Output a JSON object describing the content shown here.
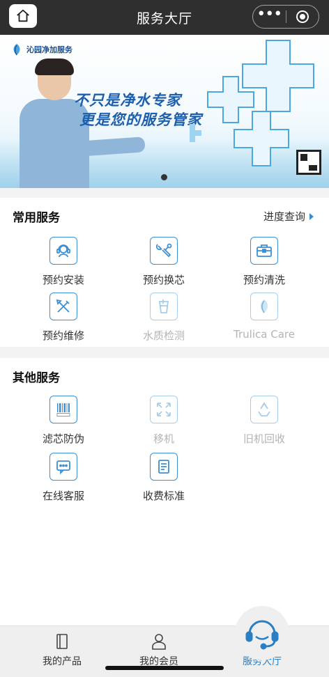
{
  "nav": {
    "title": "服务大厅",
    "menu_icon": "more-dots-icon",
    "close_icon": "target-close-icon",
    "home_icon": "home-icon"
  },
  "banner": {
    "brand": "沁园净加服务",
    "slogan_line1": "不只是净水专家",
    "slogan_line2": "更是您的服务管家"
  },
  "common": {
    "title": "常用服务",
    "link": "进度查询",
    "items": [
      {
        "label": "预约安装",
        "icon": "headset-icon",
        "enabled": true
      },
      {
        "label": "预约换芯",
        "icon": "wrench-icon",
        "enabled": true
      },
      {
        "label": "预约清洗",
        "icon": "toolbox-icon",
        "enabled": true
      },
      {
        "label": "预约维修",
        "icon": "tools-icon",
        "enabled": true
      },
      {
        "label": "水质检测",
        "icon": "water-cup-icon",
        "enabled": false
      },
      {
        "label": "Trulica Care",
        "icon": "trulica-leaf-icon",
        "enabled": false
      }
    ]
  },
  "other": {
    "title": "其他服务",
    "items": [
      {
        "label": "滤芯防伪",
        "icon": "barcode-icon",
        "enabled": true
      },
      {
        "label": "移机",
        "icon": "move-arrows-icon",
        "enabled": false
      },
      {
        "label": "旧机回收",
        "icon": "recycle-icon",
        "enabled": false
      },
      {
        "label": "在线客服",
        "icon": "chat-icon",
        "enabled": true
      },
      {
        "label": "收费标准",
        "icon": "document-icon",
        "enabled": true
      }
    ]
  },
  "tabs": [
    {
      "label": "我的产品",
      "icon": "product-icon",
      "active": false
    },
    {
      "label": "我的会员",
      "icon": "user-icon",
      "active": false
    },
    {
      "label": "服务大厅",
      "icon": "service-headset-icon",
      "active": true
    }
  ],
  "colors": {
    "accent": "#3c8fd4",
    "navbar": "#2f2f2f",
    "disabled": "#b4b4b4"
  }
}
